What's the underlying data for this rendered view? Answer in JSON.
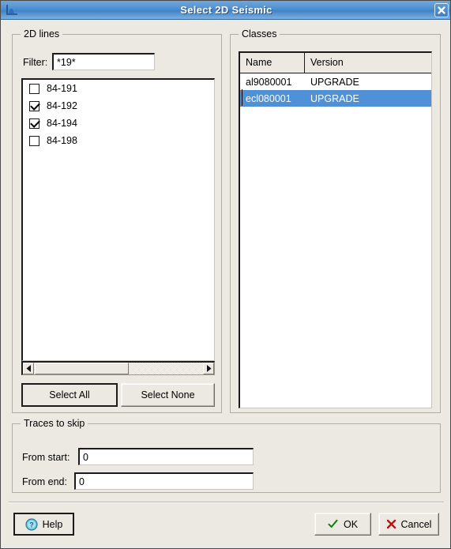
{
  "window": {
    "title": "Select 2D Seismic",
    "icon": "seismic-chart-icon",
    "close_label": "×",
    "titlebar_color": "#4f8fd0",
    "background_color": "#ece9e3"
  },
  "lines_group": {
    "title": "2D lines",
    "filter": {
      "label": "Filter:",
      "value": "*19*",
      "placeholder": ""
    },
    "items": [
      {
        "label": "84-191",
        "checked": false
      },
      {
        "label": "84-192",
        "checked": true
      },
      {
        "label": "84-194",
        "checked": true
      },
      {
        "label": "84-198",
        "checked": false
      }
    ],
    "scrollbar": {
      "left_arrow": "◀",
      "right_arrow": "▶"
    },
    "select_all_label": "Select All",
    "select_none_label": "Select None"
  },
  "classes_group": {
    "title": "Classes",
    "columns": [
      "Name",
      "Version"
    ],
    "rows": [
      {
        "name": "al9080001",
        "version": "UPGRADE",
        "selected": false
      },
      {
        "name": "ecl080001",
        "version": "UPGRADE",
        "selected": true
      }
    ],
    "selection_color": "#4f90d6"
  },
  "traces_group": {
    "title": "Traces to skip",
    "from_start": {
      "label": "From start:",
      "value": "0"
    },
    "from_end": {
      "label": "From end:",
      "value": "0"
    }
  },
  "footer": {
    "help_label": "Help",
    "help_icon": "help-question-icon",
    "ok_label": "OK",
    "ok_icon": "check-icon",
    "ok_icon_color": "#1a7a1a",
    "cancel_label": "Cancel",
    "cancel_icon": "cross-icon",
    "cancel_icon_color": "#c10d0d"
  }
}
